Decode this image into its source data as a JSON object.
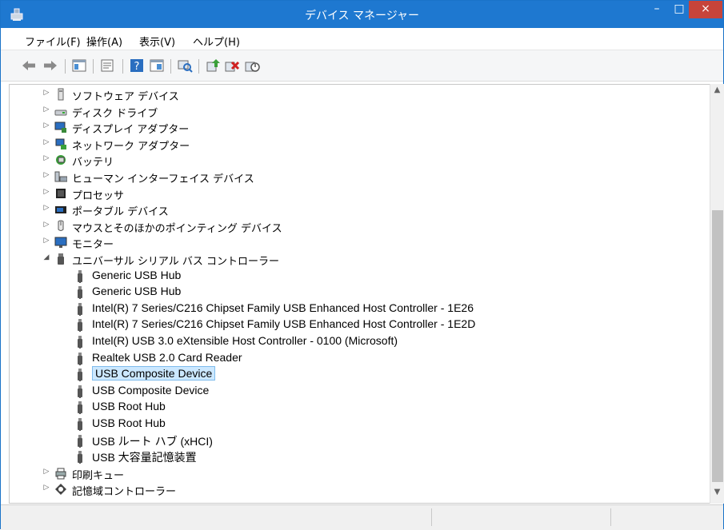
{
  "window": {
    "title": "デバイス マネージャー",
    "controls": {
      "minimize": "–",
      "maximize": "□",
      "close": "×"
    }
  },
  "menu": [
    "ファイル(F)",
    "操作(A)",
    "表示(V)",
    "ヘルプ(H)"
  ],
  "toolbar": {
    "buttons": [
      "back-icon",
      "forward-icon",
      "show-hide-console-tree-icon",
      "properties-icon",
      "help-icon",
      "view-icon",
      "scan-hardware-icon",
      "update-driver-icon",
      "uninstall-device-icon",
      "disable-device-icon"
    ]
  },
  "tree": {
    "categories_top": [
      {
        "label": "ソフトウェア デバイス",
        "icon": "software-device-icon"
      },
      {
        "label": "ディスク ドライブ",
        "icon": "disk-drive-icon"
      },
      {
        "label": "ディスプレイ アダプター",
        "icon": "display-adapter-icon"
      },
      {
        "label": "ネットワーク アダプター",
        "icon": "network-adapter-icon"
      },
      {
        "label": "バッテリ",
        "icon": "battery-icon"
      },
      {
        "label": "ヒューマン インターフェイス デバイス",
        "icon": "hid-icon"
      },
      {
        "label": "プロセッサ",
        "icon": "processor-icon"
      },
      {
        "label": "ポータブル デバイス",
        "icon": "portable-device-icon"
      },
      {
        "label": "マウスとそのほかのポインティング デバイス",
        "icon": "mouse-icon"
      },
      {
        "label": "モニター",
        "icon": "monitor-icon"
      }
    ],
    "usb_category": {
      "label": "ユニバーサル シリアル バス コントローラー",
      "icon": "usb-icon",
      "expanded": true
    },
    "usb_children": [
      "Generic USB Hub",
      "Generic USB Hub",
      "Intel(R) 7 Series/C216 Chipset Family USB Enhanced Host Controller - 1E26",
      "Intel(R) 7 Series/C216 Chipset Family USB Enhanced Host Controller - 1E2D",
      "Intel(R) USB 3.0 eXtensible Host Controller - 0100 (Microsoft)",
      "Realtek USB 2.0 Card Reader",
      "USB Composite Device",
      "USB Composite Device",
      "USB Root Hub",
      "USB Root Hub",
      "USB ルート ハブ (xHCI)",
      "USB 大容量記憶装置"
    ],
    "selected_child_index": 6,
    "categories_bottom": [
      {
        "label": "印刷キュー",
        "icon": "print-queue-icon"
      },
      {
        "label": "記憶域コントローラー",
        "icon": "storage-controller-icon"
      }
    ]
  },
  "glyphs": {
    "collapsed": "▷",
    "expanded": "◢",
    "scroll_up": "▲",
    "scroll_down": "▼"
  },
  "colors": {
    "titlebar": "#1e78d0",
    "close_button": "#c6443a",
    "selection": "#cce8ff"
  }
}
